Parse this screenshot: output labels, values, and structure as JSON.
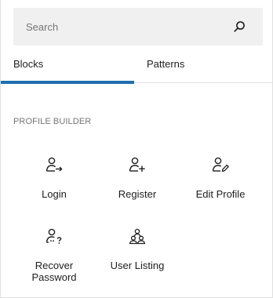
{
  "search": {
    "placeholder": "Search",
    "value": ""
  },
  "tabs": [
    {
      "label": "Blocks",
      "active": true
    },
    {
      "label": "Patterns",
      "active": false
    }
  ],
  "category": {
    "title": "PROFILE BUILDER"
  },
  "blocks": [
    {
      "label": "Login",
      "icon": "user-arrow-icon"
    },
    {
      "label": "Register",
      "icon": "user-plus-icon"
    },
    {
      "label": "Edit Profile",
      "icon": "user-pencil-icon"
    },
    {
      "label_line1": "Recover",
      "label_line2": "Password",
      "icon": "user-question-icon"
    },
    {
      "label": "User Listing",
      "icon": "users-group-icon"
    }
  ],
  "colors": {
    "accent": "#1f6fb0",
    "search_bg": "#f0f0f0",
    "muted_text": "#757575"
  }
}
